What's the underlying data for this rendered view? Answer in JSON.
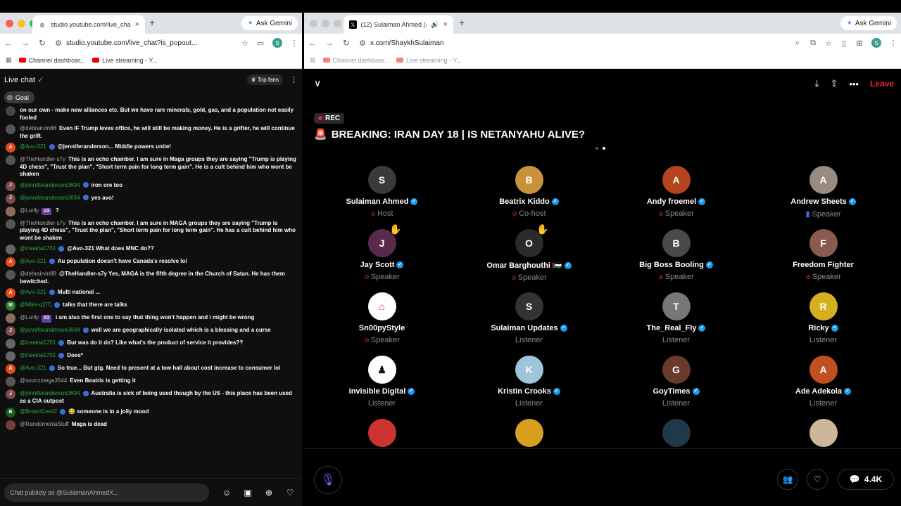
{
  "left": {
    "tab_title": "studio.youtube.com/live_cha",
    "url": "studio.youtube.com/live_chat?is_popout...",
    "ask_gemini": "Ask Gemini",
    "profile_letter": "S",
    "bookmarks": [
      "Channel dashboar...",
      "Live streaming - Y..."
    ],
    "chat_title": "Live chat",
    "top_fans": "Top fans",
    "goal": "Goal",
    "input_placeholder": "Chat publicly as @SulaimanAhmedX...",
    "messages": [
      {
        "av": "",
        "avcolor": "#444",
        "author": "",
        "badge": "",
        "text": "on our own - make new alliances etc. But we have rare minerals, gold, gas, and a population not easily fooled"
      },
      {
        "av": "",
        "avcolor": "#555",
        "author": "@debrairvin88",
        "grey": true,
        "badge": "",
        "text": "Even IF Trump leves office, he will still be making money. He is a grifter, he will continue the grift."
      },
      {
        "av": "A",
        "avcolor": "#e64a19",
        "author": "@Avo-321",
        "badge": "v",
        "text": "@jenniferanderson... Middle powers unite!"
      },
      {
        "av": "",
        "avcolor": "#555",
        "author": "@TheHandler-s7y",
        "grey": true,
        "badge": "",
        "text": "This is an echo chamber. I am sure in Maga groups they are saying \"Trump is playing 4D chess\", \"Trust the plan\", \"Short term pain for long term gain\". He is a cult behind him who wont be shaken"
      },
      {
        "av": "J",
        "avcolor": "#7b4a4a",
        "author": "@jenniferanderson3694",
        "badge": "v",
        "text": "iron ore too"
      },
      {
        "av": "J",
        "avcolor": "#7b4a4a",
        "author": "@jenniferanderson3694",
        "badge": "v",
        "text": "yes avo!"
      },
      {
        "av": "",
        "avcolor": "#8a6d5a",
        "author": "@Lurlly",
        "grey": true,
        "badge": "#3",
        "text": "?"
      },
      {
        "av": "",
        "avcolor": "#555",
        "author": "@TheHandler-s7y",
        "grey": true,
        "badge": "",
        "text": "This is an echo chamber. I am sure in MAGA groups they are saying \"Trump is playing 4D chess\", \"Trust the plan\", \"Short term pain for long term gain\". He has a cult behind him who wont be shaken"
      },
      {
        "av": "",
        "avcolor": "#666",
        "author": "@insekta1701",
        "badge": "v",
        "text": "@Avo-321 What does MNC do??"
      },
      {
        "av": "A",
        "avcolor": "#e64a19",
        "author": "@Avo-321",
        "badge": "v",
        "text": "Au population doesn't have Canada's resolve lol"
      },
      {
        "av": "",
        "avcolor": "#555",
        "author": "@debrairvin88",
        "grey": true,
        "badge": "",
        "text": "@TheHandler-s7y Yes, MAGA is the fifth degree in the Church of Satan. He has them bewitched."
      },
      {
        "av": "A",
        "avcolor": "#e64a19",
        "author": "@Avo-321",
        "badge": "v",
        "text": "Multi national ..."
      },
      {
        "av": "M",
        "avcolor": "#2e7d32",
        "author": "@Mike-q2f7j",
        "badge": "v",
        "text": "talks that there are talks"
      },
      {
        "av": "",
        "avcolor": "#8a6d5a",
        "author": "@Lurlly",
        "grey": true,
        "badge": "#3",
        "text": "i am also the first one to say that thing won't happen and i might be wrong"
      },
      {
        "av": "J",
        "avcolor": "#7b4a4a",
        "author": "@jenniferanderson3694",
        "badge": "v",
        "text": "well we are geographically isolated which is a blessing and a curse"
      },
      {
        "av": "",
        "avcolor": "#666",
        "author": "@insekta1701",
        "badge": "v",
        "text": "But was do it do? Like what's the product of service it provides??"
      },
      {
        "av": "",
        "avcolor": "#666",
        "author": "@insekta1701",
        "badge": "v",
        "text": "Does*"
      },
      {
        "av": "A",
        "avcolor": "#e64a19",
        "author": "@Avo-321",
        "badge": "v",
        "text": "So true... But gtg. Need to present at a tow hall about cost increase to consumer lol"
      },
      {
        "av": "",
        "avcolor": "#555",
        "author": "@sounzmega3544",
        "grey": true,
        "badge": "",
        "text": "Even Beatrix is getting it"
      },
      {
        "av": "J",
        "avcolor": "#7b4a4a",
        "author": "@jenniferanderson3694",
        "badge": "v",
        "text": "Australia is sick of being used though by the US - this place has been used as a CIA outpost"
      },
      {
        "av": "B",
        "avcolor": "#1b5e20",
        "author": "@BrownDevil2",
        "badge": "v",
        "text": "😂  someone is in a jolly mood"
      },
      {
        "av": "",
        "avcolor": "#7a3b3b",
        "author": "@RandomoniaStuff",
        "grey": true,
        "badge": "",
        "text": "Maga is dead"
      }
    ]
  },
  "right": {
    "tab_title": "(12) Sulaiman Ahmed (@S",
    "url": "x.com/ShaykhSulaiman",
    "ask_gemini": "Ask Gemini",
    "profile_letter": "S",
    "bookmarks": [
      "Channel dashboar...",
      "Live streaming - Y..."
    ],
    "leave": "Leave",
    "rec": "REC",
    "title": "BREAKING: IRAN DAY 18 | IS NETANYAHU ALIVE?",
    "count": "4.4K",
    "participants": [
      {
        "name": "Sulaiman Ahmed",
        "role": "Host",
        "verified": true,
        "mic": true,
        "color": "#3a3a3a",
        "initial": "S"
      },
      {
        "name": "Beatrix Kiddo",
        "role": "Co-host",
        "verified": true,
        "mic": true,
        "color": "#c7933a",
        "initial": "B"
      },
      {
        "name": "Andy froemel",
        "role": "Speaker",
        "verified": true,
        "mic": true,
        "color": "#b3441e",
        "initial": "A"
      },
      {
        "name": "Andrew Sheets",
        "role": "Speaker",
        "verified": true,
        "mic": false,
        "color": "#9a8a80",
        "initial": "A",
        "flag": true
      },
      {
        "name": "Jay Scott",
        "role": "Speaker",
        "verified": true,
        "mic": true,
        "color": "#5a2a4a",
        "initial": "J",
        "hand": true
      },
      {
        "name": "Omar Barghouthi 🇵🇸",
        "role": "Speaker",
        "verified": true,
        "mic": true,
        "color": "#2b2b2b",
        "initial": "O",
        "hand": true
      },
      {
        "name": "Big Boss Booling",
        "role": "Speaker",
        "verified": true,
        "mic": true,
        "color": "#4a4a4a",
        "initial": "B"
      },
      {
        "name": "Freedom Fighter",
        "role": "Speaker",
        "verified": false,
        "mic": true,
        "color": "#8a5a50",
        "initial": "F"
      },
      {
        "name": "Sn00pyStyle",
        "role": "Speaker",
        "verified": false,
        "mic": true,
        "color": "#ffffff",
        "initial": "",
        "snoopy": true
      },
      {
        "name": "Sulaiman Updates",
        "role": "Listener",
        "verified": true,
        "mic": false,
        "color": "#333",
        "initial": "S"
      },
      {
        "name": "The_Real_Fly",
        "role": "Listener",
        "verified": true,
        "mic": false,
        "color": "#777",
        "initial": "T"
      },
      {
        "name": "Ricky",
        "role": "Listener",
        "verified": true,
        "mic": false,
        "color": "#d4b020",
        "initial": "R"
      },
      {
        "name": "invisible Digital",
        "role": "Listener",
        "verified": true,
        "mic": false,
        "color": "#ffffff",
        "initial": "",
        "dark": true
      },
      {
        "name": "Kristin Crooks",
        "role": "Listener",
        "verified": true,
        "mic": false,
        "color": "#9ec5d8",
        "initial": "K"
      },
      {
        "name": "GoyTimes",
        "role": "Listener",
        "verified": true,
        "mic": false,
        "color": "#6a3a2a",
        "initial": "G"
      },
      {
        "name": "Ade Adekola",
        "role": "Listener",
        "verified": true,
        "mic": false,
        "color": "#c05020",
        "initial": "A"
      },
      {
        "name": "",
        "role": "",
        "verified": false,
        "mic": false,
        "color": "#c33",
        "initial": ""
      },
      {
        "name": "",
        "role": "",
        "verified": false,
        "mic": false,
        "color": "#d9a020",
        "initial": ""
      },
      {
        "name": "",
        "role": "",
        "verified": false,
        "mic": false,
        "color": "#1e3a4a",
        "initial": ""
      },
      {
        "name": "",
        "role": "",
        "verified": false,
        "mic": false,
        "color": "#cdb79a",
        "initial": ""
      }
    ]
  }
}
